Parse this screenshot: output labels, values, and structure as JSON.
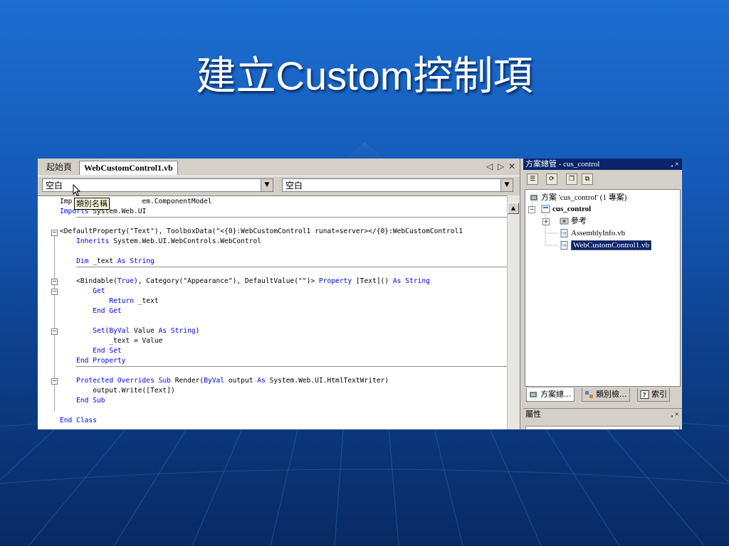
{
  "slide": {
    "title": "建立Custom控制項"
  },
  "colors": {
    "keyword": "#0000ff",
    "titlebar": "#0a246a",
    "selection": "#0a246a"
  },
  "editor": {
    "tabs": [
      "起始頁",
      "WebCustomControl1.vb"
    ],
    "tab_controls": [
      "◁",
      "▷",
      "✕"
    ],
    "combo_left": "空白",
    "combo_right": "空白",
    "tooltip": "類別名稱",
    "code_lines": [
      [
        [
          "",
          "Imp"
        ],
        [
          "",
          "                 em.ComponentModel"
        ]
      ],
      [
        [
          "kw",
          "Imports"
        ],
        [
          "",
          " System.Web.UI"
        ]
      ],
      [
        [
          "",
          ""
        ]
      ],
      [
        [
          "",
          "<DefaultProperty(\"Text\"), ToolboxData(\"<{0}:WebCustomControl1 runat=server></{0}:WebCustomControl1"
        ]
      ],
      [
        [
          "",
          "    "
        ],
        [
          "kw",
          "Inherits"
        ],
        [
          "",
          " System.Web.UI.WebControls.WebControl"
        ]
      ],
      [
        [
          "",
          ""
        ]
      ],
      [
        [
          "",
          "    "
        ],
        [
          "kw",
          "Dim"
        ],
        [
          "",
          " _text "
        ],
        [
          "kw",
          "As"
        ],
        [
          "",
          " "
        ],
        [
          "kw",
          "String"
        ]
      ],
      [
        [
          "",
          ""
        ]
      ],
      [
        [
          "",
          "    <Bindable("
        ],
        [
          "kw",
          "True"
        ],
        [
          "",
          "), Category(\"Appearance\"), DefaultValue(\"\")> "
        ],
        [
          "kw",
          "Property"
        ],
        [
          "",
          " [Text]() "
        ],
        [
          "kw",
          "As"
        ],
        [
          "",
          " "
        ],
        [
          "kw",
          "String"
        ]
      ],
      [
        [
          "",
          "        "
        ],
        [
          "kw",
          "Get"
        ]
      ],
      [
        [
          "",
          "            "
        ],
        [
          "kw",
          "Return"
        ],
        [
          "",
          " _text"
        ]
      ],
      [
        [
          "",
          "        "
        ],
        [
          "kw",
          "End Get"
        ]
      ],
      [
        [
          "",
          ""
        ]
      ],
      [
        [
          "",
          "        "
        ],
        [
          "kw",
          "Set"
        ],
        [
          "",
          "("
        ],
        [
          "kw",
          "ByVal"
        ],
        [
          "",
          " Value "
        ],
        [
          "kw",
          "As"
        ],
        [
          "",
          " "
        ],
        [
          "kw",
          "String"
        ],
        [
          "",
          ")"
        ]
      ],
      [
        [
          "",
          "            _text = Value"
        ]
      ],
      [
        [
          "",
          "        "
        ],
        [
          "kw",
          "End Set"
        ]
      ],
      [
        [
          "",
          "    "
        ],
        [
          "kw",
          "End Property"
        ]
      ],
      [
        [
          "",
          ""
        ]
      ],
      [
        [
          "",
          "    "
        ],
        [
          "kw",
          "Protected Overrides Sub"
        ],
        [
          "",
          " Render("
        ],
        [
          "kw",
          "ByVal"
        ],
        [
          "",
          " output "
        ],
        [
          "kw",
          "As"
        ],
        [
          "",
          " System.Web.UI.HtmlTextWriter)"
        ]
      ],
      [
        [
          "",
          "        output.Write([Text])"
        ]
      ],
      [
        [
          "",
          "    "
        ],
        [
          "kw",
          "End Sub"
        ]
      ],
      [
        [
          "",
          ""
        ]
      ],
      [
        [
          "kw",
          "End Class"
        ]
      ]
    ]
  },
  "solution_explorer": {
    "title": "方案總管 - cus_control",
    "title_controls": "ₔ ×",
    "tree": {
      "solution": "方案 'cus_control' (1 專案)",
      "project": "cus_control",
      "references": "參考",
      "file1": "AssemblyInfo.vb",
      "file2": "WebCustomControl1.vb"
    },
    "bottom_tabs": [
      "方案總...",
      "類別檢...",
      "索引"
    ],
    "bottom_tab_icons": [
      "solution-icon",
      "class-view-icon",
      "index-icon"
    ]
  },
  "properties": {
    "title": "屬性",
    "title_controls": "ₔ ×"
  }
}
